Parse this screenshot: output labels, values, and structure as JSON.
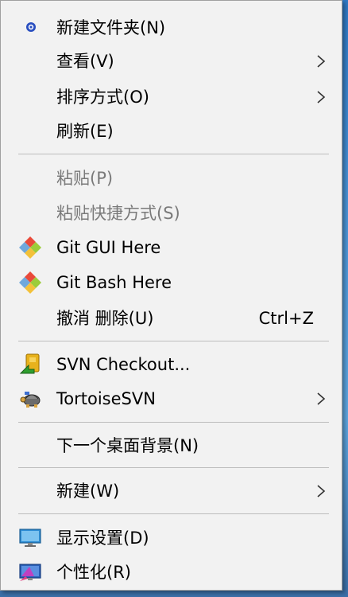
{
  "menu": {
    "new_folder": "新建文件夹(N)",
    "view": "查看(V)",
    "sort_by": "排序方式(O)",
    "refresh": "刷新(E)",
    "paste": "粘贴(P)",
    "paste_shortcut": "粘贴快捷方式(S)",
    "git_gui": "Git GUI Here",
    "git_bash": "Git Bash Here",
    "undo_delete": "撤消 删除(U)",
    "undo_shortcut": "Ctrl+Z",
    "svn_checkout": "SVN Checkout...",
    "tortoise_svn": "TortoiseSVN",
    "next_background": "下一个桌面背景(N)",
    "new": "新建(W)",
    "display_settings": "显示设置(D)",
    "personalize": "个性化(R)"
  },
  "icons": {
    "new_folder": "shield-dot-icon",
    "git": "git-diamond-icon",
    "svn_checkout": "svn-checkout-icon",
    "tortoise": "tortoise-icon",
    "display": "monitor-icon",
    "personalize": "personalize-monitor-icon",
    "submenu": "chevron-right-icon"
  }
}
